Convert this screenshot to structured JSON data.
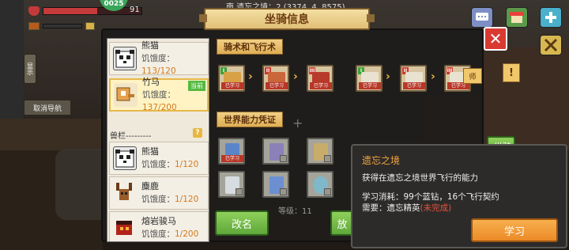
{
  "hud": {
    "health_value": "91",
    "level_badge": "0025",
    "coordinates": "南  遗忘之境：2 (3374, 4, 8575)"
  },
  "side": {
    "show_label": "显示",
    "cancel_nav_label": "取消导航"
  },
  "panel": {
    "title": "坐骑信息",
    "close_symbol": "✕"
  },
  "mounts": {
    "selected_index": 1,
    "current_tag": "当前",
    "hunger_label": "饥饿度：",
    "owned": [
      {
        "name": "熊猫",
        "hunger": "113/120",
        "icon": "panda-icon"
      },
      {
        "name": "竹马",
        "hunger": "137/200",
        "icon": "bamboo-horse-icon"
      }
    ],
    "stable_label": "兽栏---------",
    "help_symbol": "?",
    "stable": [
      {
        "name": "熊猫",
        "hunger": "1/120",
        "icon": "panda-icon"
      },
      {
        "name": "麋鹿",
        "hunger": "1/120",
        "icon": "elk-icon"
      },
      {
        "name": "熔岩骏马",
        "hunger": "1/200",
        "icon": "lava-horse-icon"
      }
    ]
  },
  "riding": {
    "section_title": "骑术和飞行术",
    "learned_label": "已学习",
    "nodes": [
      {
        "level": "I",
        "icon": "riding-skill-icon",
        "learned": true
      },
      {
        "level": "II",
        "icon": "riding-skill-icon",
        "learned": true
      },
      {
        "level": "III",
        "icon": "riding-skill-icon",
        "learned": true
      },
      {
        "level": "I",
        "icon": "flight-wing-icon",
        "learned": true
      },
      {
        "level": "II",
        "icon": "flight-wing-icon",
        "learned": true
      },
      {
        "level": "III",
        "icon": "flight-wing-icon",
        "learned": true
      }
    ]
  },
  "world": {
    "section_title": "世界能力凭证",
    "tokens": [
      {
        "icon": "blue-flag-icon",
        "learned": true
      },
      {
        "icon": "purple-flag-icon",
        "learned": false
      },
      {
        "icon": "gold-flag-icon",
        "learned": false
      },
      {
        "icon": "white-flag-icon",
        "learned": false
      },
      {
        "icon": "blue-flag-icon",
        "learned": false
      },
      {
        "icon": "portal-flag-icon",
        "learned": false
      }
    ],
    "level_text": "等级：11"
  },
  "buttons": {
    "rename": "改名",
    "partial_right": "放",
    "partial_green": "纵骑"
  },
  "right_peek": {
    "label": "师",
    "exclamation": "!"
  },
  "tooltip": {
    "title": "遗忘之境",
    "description": "获得在遗忘之境世界飞行的能力",
    "cost": "学习消耗：99个蓝钻，16个飞行契约",
    "requirement_label": "需要：遗忘精英",
    "requirement_status": "(未完成)",
    "learn_button": "学习"
  },
  "colors": {
    "accent_orange": "#f2a440",
    "learn_button": "#eb8a27",
    "close_red": "#d83a32",
    "rename_green": "#5ea83a",
    "incomplete_red": "#e5533d"
  }
}
